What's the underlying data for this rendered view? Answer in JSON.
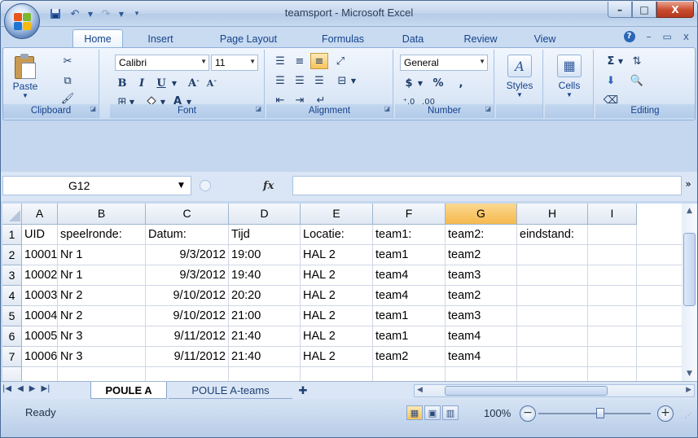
{
  "window": {
    "title": "teamsport - Microsoft Excel",
    "minimize_glyph": "–",
    "maximize_glyph": "□",
    "close_glyph": "X"
  },
  "quick_access": {
    "icons": [
      "save-icon",
      "undo-icon",
      "redo-icon",
      "customize-icon"
    ]
  },
  "tabs": [
    "Home",
    "Insert",
    "Page Layout",
    "Formulas",
    "Data",
    "Review",
    "View"
  ],
  "active_tab": "Home",
  "ribbon": {
    "clipboard": {
      "label": "Clipboard",
      "paste_label": "Paste"
    },
    "font": {
      "label": "Font",
      "font_name": "Calibri",
      "font_size": "11"
    },
    "alignment": {
      "label": "Alignment"
    },
    "number": {
      "label": "Number",
      "format": "General",
      "currency": "$",
      "percent": "%",
      "comma": ","
    },
    "styles": {
      "label": "Styles"
    },
    "cells": {
      "label": "Cells"
    },
    "editing": {
      "label": "Editing"
    }
  },
  "formula_bar": {
    "name_box": "G12",
    "fx_label": "fx",
    "formula": ""
  },
  "columns": [
    "A",
    "B",
    "C",
    "D",
    "E",
    "F",
    "G",
    "H",
    "I"
  ],
  "selected_column": "G",
  "rows": [
    {
      "n": "1",
      "cells": [
        "UID",
        "speelronde:",
        "Datum:",
        "Tijd",
        "Locatie:",
        "team1:",
        "team2:",
        "eindstand:",
        ""
      ]
    },
    {
      "n": "2",
      "cells": [
        "10001",
        "Nr 1",
        "9/3/2012",
        "19:00",
        "HAL 2",
        "team1",
        "team2",
        "",
        ""
      ]
    },
    {
      "n": "3",
      "cells": [
        "10002",
        "Nr 1",
        "9/3/2012",
        "19:40",
        "HAL 2",
        "team4",
        "team3",
        "",
        ""
      ]
    },
    {
      "n": "4",
      "cells": [
        "10003",
        "Nr 2",
        "9/10/2012",
        "20:20",
        "HAL 2",
        "team4",
        "team2",
        "",
        ""
      ]
    },
    {
      "n": "5",
      "cells": [
        "10004",
        "Nr 2",
        "9/10/2012",
        "21:00",
        "HAL 2",
        "team1",
        "team3",
        "",
        ""
      ]
    },
    {
      "n": "6",
      "cells": [
        "10005",
        "Nr 3",
        "9/11/2012",
        "21:40",
        "HAL 2",
        "team1",
        "team4",
        "",
        ""
      ]
    },
    {
      "n": "7",
      "cells": [
        "10006",
        "Nr 3",
        "9/11/2012",
        "21:40",
        "HAL 2",
        "team2",
        "team4",
        "",
        ""
      ]
    }
  ],
  "sheets": [
    "POULE A",
    "POULE A-teams"
  ],
  "active_sheet": "POULE A",
  "status": {
    "ready": "Ready",
    "zoom": "100%"
  }
}
